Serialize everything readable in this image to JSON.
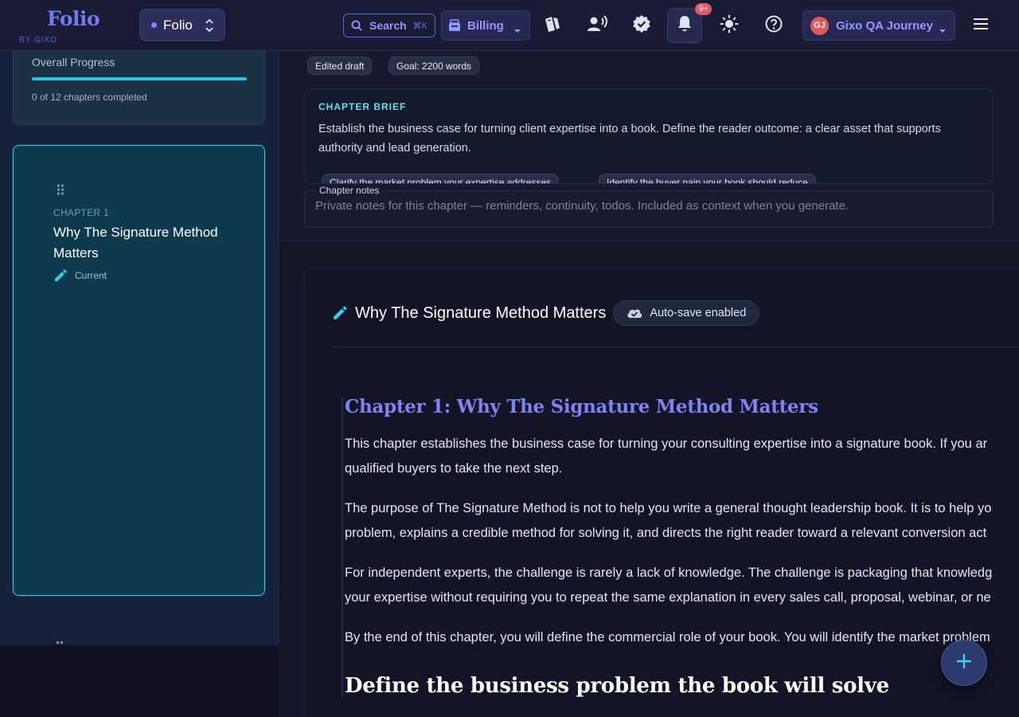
{
  "header": {
    "logo": "Folio",
    "logo_sub": "BY GIXO",
    "workspace": "Folio",
    "search_label": "Search",
    "search_shortcut": "⌘K",
    "billing_label": "Billing",
    "notifications_badge": "9+",
    "user_initials": "GJ",
    "user_name": "Gixo QA Journey"
  },
  "sidebar": {
    "progress_title": "Overall Progress",
    "progress_fraction": 0,
    "progress_text": "0 of 12 chapters completed",
    "chapter": {
      "number": "CHAPTER 1",
      "title": "Why The Signature Method Matters",
      "status": "Current"
    }
  },
  "main": {
    "tags": [
      "Edited draft",
      "Goal: 2200 words"
    ],
    "brief": {
      "label": "CHAPTER BRIEF",
      "text": "Establish the business case for turning client expertise into a book. Define the reader outcome: a clear asset that supports authority and lead generation.",
      "chips": [
        "Clarify the market problem your expertise addresses",
        "Identify the buyer pain your book should reduce"
      ]
    },
    "notes": {
      "label": "Chapter notes",
      "placeholder": "Private notes for this chapter — reminders, continuity, todos. Included as context when you generate."
    },
    "editor": {
      "title": "Why The Signature Method Matters",
      "autosave": "Auto-save enabled",
      "heading": "Chapter 1: Why The Signature Method Matters",
      "paragraphs": [
        [
          "This chapter establishes the business case for turning your consulting expertise into a signature book. If you ar",
          "qualified buyers to take the next step."
        ],
        [
          "The purpose of The Signature Method is not to help you write a general thought leadership book. It is to help yo",
          "problem, explains a credible method for solving it, and directs the right reader toward a relevant conversion act"
        ],
        [
          "For independent experts, the challenge is rarely a lack of knowledge. The challenge is packaging that knowledg",
          "your expertise without requiring you to repeat the same explanation in every sales call, proposal, webinar, or ne"
        ],
        [
          "By the end of this chapter, you will define the commercial role of your book. You will identify the market problem"
        ]
      ],
      "subheading": "Define the business problem the book will solve"
    }
  },
  "colors": {
    "accent": "#6f7bf0",
    "cyan": "#22c4e6",
    "badge": "#e25a6a"
  },
  "icons": [
    "search-icon",
    "billing-icon",
    "cards-icon",
    "voice-icon",
    "verified-icon",
    "bell-icon",
    "sun-icon",
    "help-icon",
    "menu-icon",
    "drag-icon",
    "pencil-icon",
    "cloud-check-icon",
    "plus-icon"
  ]
}
